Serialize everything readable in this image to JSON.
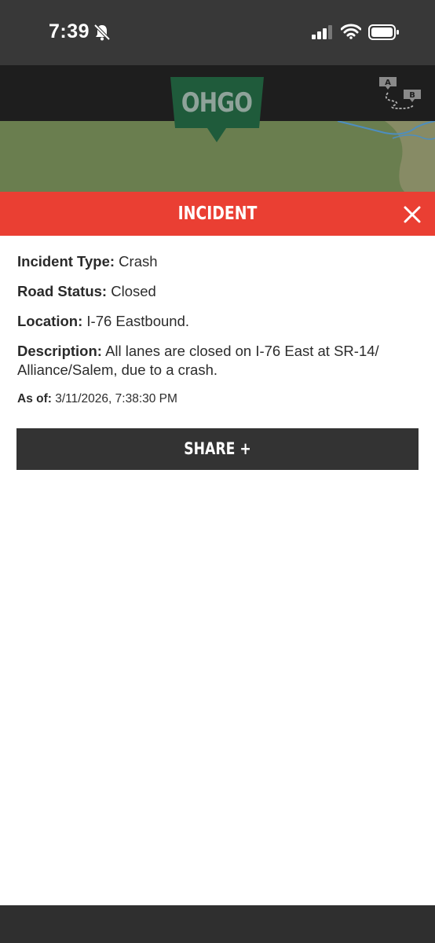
{
  "status_bar": {
    "time": "7:39",
    "icons": [
      "bell-slash-icon",
      "cellular-signal-icon",
      "wifi-icon",
      "battery-icon"
    ]
  },
  "header": {
    "logo_text": "OHGO",
    "route_icon_labels": [
      "A",
      "B"
    ]
  },
  "incident": {
    "title": "INCIDENT",
    "close_icon": "close-icon",
    "fields": [
      {
        "label": "Incident Type:",
        "value": "Crash"
      },
      {
        "label": "Road Status:",
        "value": "Closed"
      },
      {
        "label": "Location:",
        "value": "I-76 Eastbound."
      },
      {
        "label": "Description:",
        "value": "All lanes are closed on I-76 East at SR-14/ Alliance/Salem, due to a crash."
      }
    ],
    "as_of_label": "As of:",
    "as_of_value": "3/11/2026, 7:38:30 PM",
    "share_label": "SHARE +"
  },
  "colors": {
    "status_bar": "#383838",
    "header": "#1e1e1e",
    "logo_green": "#1f5b3b",
    "map_green": "#6a7e4f",
    "incident_red": "#ea3f33",
    "share_button": "#333333"
  }
}
